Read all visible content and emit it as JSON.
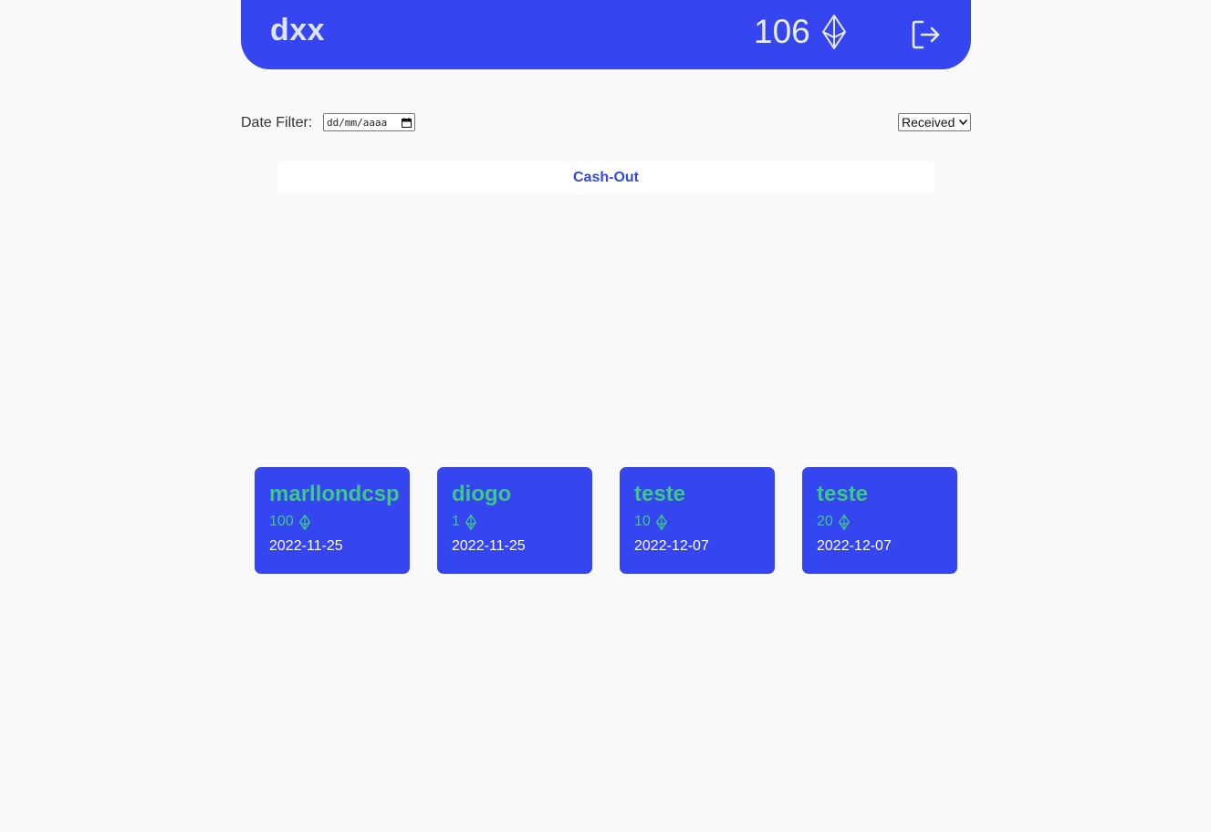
{
  "header": {
    "username": "dxx",
    "balance": "106",
    "currency_icon": "ethereum-icon",
    "logout_icon": "logout-icon"
  },
  "filters": {
    "date_label": "Date Filter:",
    "date_placeholder": "dd/mm/aaaa",
    "type_selected": "Received"
  },
  "actions": {
    "cashout_label": "Cash-Out"
  },
  "transactions": [
    {
      "name": "marllondcsp",
      "amount": "100",
      "date": "2022-11-25"
    },
    {
      "name": "diogo",
      "amount": "1",
      "date": "2022-11-25"
    },
    {
      "name": "teste",
      "amount": "10",
      "date": "2022-12-07"
    },
    {
      "name": "teste",
      "amount": "20",
      "date": "2022-12-07"
    }
  ],
  "colors": {
    "primary": "#3546f0",
    "accent_green": "#3cc985",
    "background": "#f9f9f9"
  }
}
